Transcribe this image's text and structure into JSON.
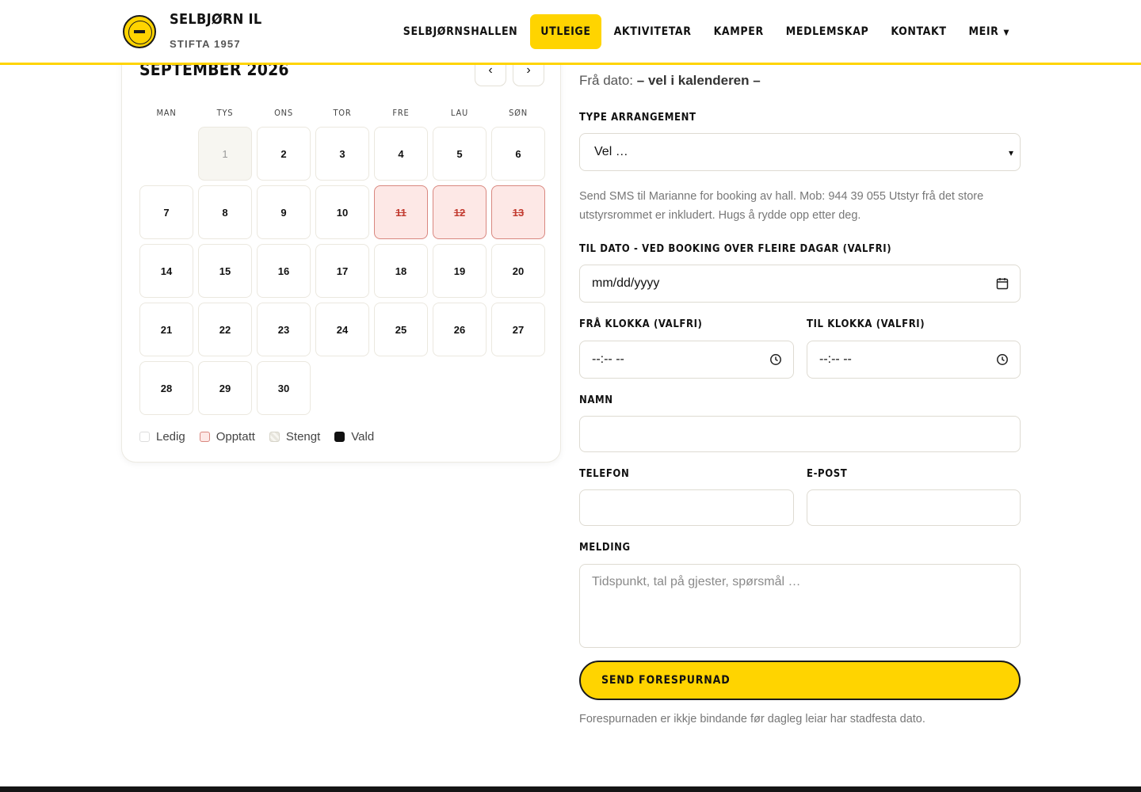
{
  "brand": {
    "name": "SELBJØRN IL",
    "sub": "STIFTA 1957"
  },
  "nav": [
    {
      "label": "SELBJØRNSHALLEN",
      "active": false
    },
    {
      "label": "UTLEIGE",
      "active": true
    },
    {
      "label": "AKTIVITETAR",
      "active": false
    },
    {
      "label": "KAMPER",
      "active": false
    },
    {
      "label": "MEDLEMSKAP",
      "active": false
    },
    {
      "label": "KONTAKT",
      "active": false
    },
    {
      "label": "MEIR",
      "active": false
    }
  ],
  "calendar": {
    "title": "SEPTEMBER 2026",
    "prev": "‹",
    "next": "›",
    "weekdays": [
      "MAN",
      "TYS",
      "ONS",
      "TOR",
      "FRE",
      "LAU",
      "SØN"
    ],
    "lead_blanks": 1,
    "days": [
      {
        "n": "1",
        "state": "closed"
      },
      {
        "n": "2",
        "state": "free"
      },
      {
        "n": "3",
        "state": "free"
      },
      {
        "n": "4",
        "state": "free"
      },
      {
        "n": "5",
        "state": "free"
      },
      {
        "n": "6",
        "state": "free"
      },
      {
        "n": "7",
        "state": "free"
      },
      {
        "n": "8",
        "state": "free"
      },
      {
        "n": "9",
        "state": "free"
      },
      {
        "n": "10",
        "state": "free"
      },
      {
        "n": "11",
        "state": "busy"
      },
      {
        "n": "12",
        "state": "busy"
      },
      {
        "n": "13",
        "state": "busy"
      },
      {
        "n": "14",
        "state": "free"
      },
      {
        "n": "15",
        "state": "free"
      },
      {
        "n": "16",
        "state": "free"
      },
      {
        "n": "17",
        "state": "free"
      },
      {
        "n": "18",
        "state": "free"
      },
      {
        "n": "19",
        "state": "free"
      },
      {
        "n": "20",
        "state": "free"
      },
      {
        "n": "21",
        "state": "free"
      },
      {
        "n": "22",
        "state": "free"
      },
      {
        "n": "23",
        "state": "free"
      },
      {
        "n": "24",
        "state": "free"
      },
      {
        "n": "25",
        "state": "free"
      },
      {
        "n": "26",
        "state": "free"
      },
      {
        "n": "27",
        "state": "free"
      },
      {
        "n": "28",
        "state": "free"
      },
      {
        "n": "29",
        "state": "free"
      },
      {
        "n": "30",
        "state": "free"
      }
    ],
    "legend": [
      {
        "label": "Ledig",
        "kind": "free"
      },
      {
        "label": "Opptatt",
        "kind": "busy"
      },
      {
        "label": "Stengt",
        "kind": "closed"
      },
      {
        "label": "Vald",
        "kind": "selected"
      }
    ]
  },
  "form": {
    "from_date_label": "Frå dato:",
    "from_date_value": "– vel i kalenderen –",
    "type_label": "TYPE ARRANGEMENT",
    "type_value": "Vel …",
    "help_text": "Send SMS til Marianne for booking av hall. Mob: 944 39 055 Utstyr frå det store utstyrsrommet er inkludert. Hugs å rydde opp etter deg.",
    "to_date_label": "TIL DATO - VED BOOKING OVER FLEIRE DAGAR (VALFRI)",
    "to_date_placeholder": "mm/dd/yyyy",
    "from_time_label": "FRÅ KLOKKA (VALFRI)",
    "to_time_label": "TIL KLOKKA (VALFRI)",
    "time_placeholder": "--:-- --",
    "name_label": "NAMN",
    "phone_label": "TELEFON",
    "email_label": "E-POST",
    "message_label": "MELDING",
    "message_placeholder": "Tidspunkt, tal på gjester, spørsmål …",
    "submit_label": "SEND FORESPURNAD",
    "note": "Forespurnaden er ikkje bindande før dagleg leiar har stadfesta dato."
  },
  "icons": {
    "calendar": "calendar-icon",
    "clock": "clock-icon",
    "caret": "chevron-down-icon"
  },
  "colors": {
    "accent": "#ffd400",
    "busy": "#fde8e6",
    "busy_text": "#c23a2f",
    "dark": "#111111"
  }
}
